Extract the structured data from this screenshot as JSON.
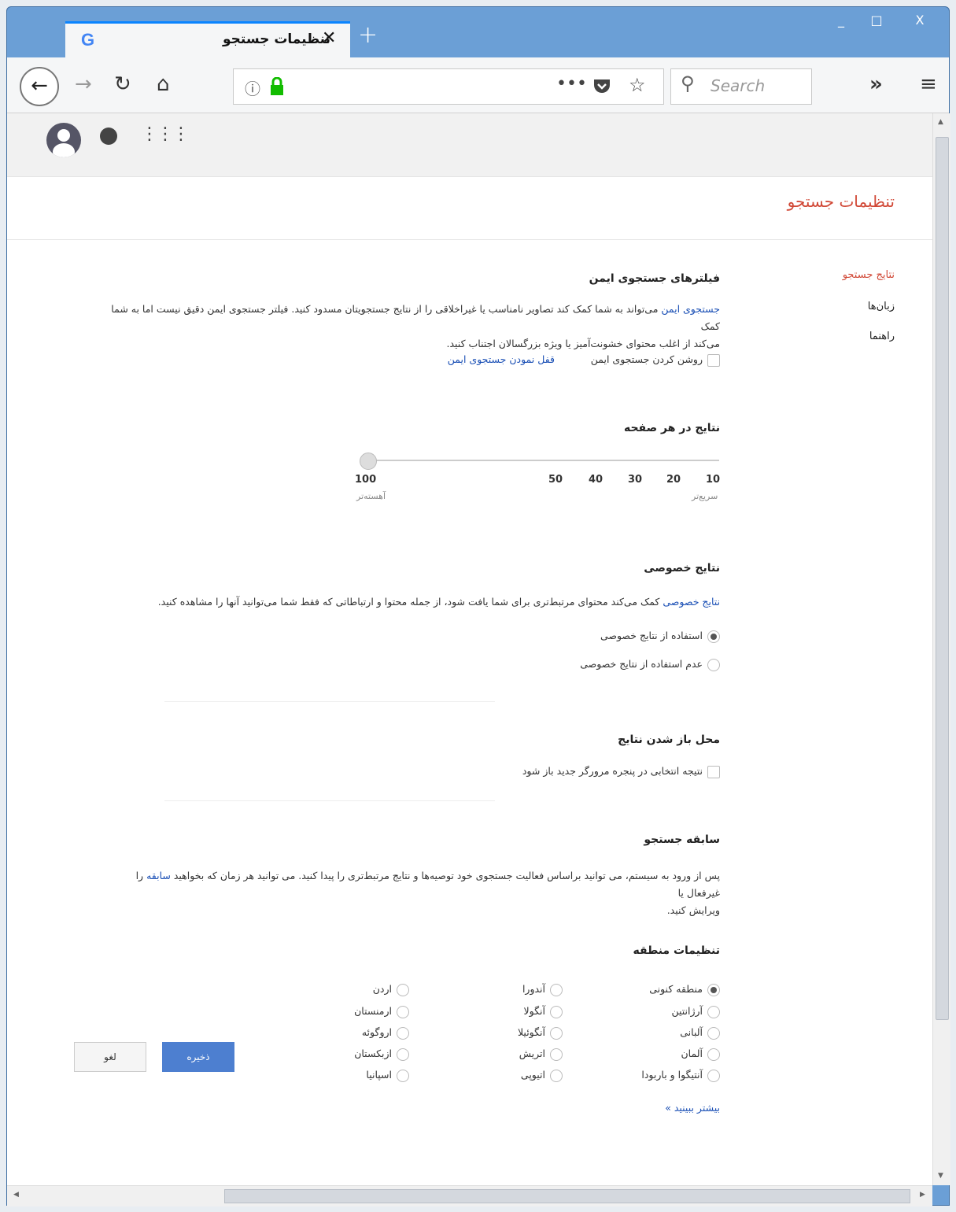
{
  "browser": {
    "tab_title": "تنظیمات جستجو",
    "tab_favicon": "G",
    "close_glyph": "✕",
    "new_tab_glyph": "+",
    "url_info_glyph": "ⓘ",
    "search_placeholder": "Search",
    "window_controls": [
      "_",
      "□",
      "X"
    ]
  },
  "page": {
    "title": "تنظیمات جستجو",
    "sidebar": [
      "نتایج جستجو",
      "زبان‌ها",
      "راهنما"
    ],
    "safesearch": {
      "title": "فیلترهای جستجوی ایمن",
      "link": "جستجوی ایمن",
      "text1": " می‌تواند به شما کمک کند تصاویر نامناسب یا غیراخلاقی را از نتایج جستجویتان مسدود کنید. فیلتر جستجوی ایمن دقیق نیست اما به شما کمک",
      "text2": "می‌کند از اغلب محتوای خشونت‌آمیز یا ویژه بزرگسالان اجتناب کنید.",
      "checkbox_label": "روشن کردن جستجوی ایمن",
      "lock_link": "قفل نمودن جستجوی ایمن"
    },
    "results_per_page": {
      "title": "نتایج در هر صفحه",
      "ticks": [
        "10",
        "20",
        "30",
        "40",
        "50",
        "100"
      ],
      "faster": "سریع‌تر",
      "slower": "آهسته‌تر",
      "selected": "100"
    },
    "private_results": {
      "title": "نتایج خصوصی",
      "link": "نتایج خصوصی",
      "text": " کمک می‌کند محتوای مرتبط‌تری برای شما یافت شود، از جمله محتوا و ارتباطاتی که فقط شما می‌توانید آنها را مشاهده کنید.",
      "opt_use": "استفاده از نتایج خصوصی",
      "opt_nouse": "عدم استفاده از نتایج خصوصی"
    },
    "open_results": {
      "title": "محل باز شدن نتایج",
      "checkbox_label": "نتیجه انتخابی در پنجره مرورگر جدید باز شود"
    },
    "history": {
      "title": "سابقه جستجو",
      "text1": "پس از ورود به سیستم، می توانید براساس فعالیت جستجوی خود توصیه‌ها و نتایج مرتبط‌تری را پیدا کنید. می توانید هر زمان که بخواهید ",
      "link": "سابقه",
      "text2": " را غیرفعال یا",
      "text3": "ویرایش کنید."
    },
    "region": {
      "title": "تنظیمات منطقه",
      "col1": [
        "منطقه کنونی",
        "آرژانتین",
        "آلبانی",
        "آلمان",
        "آنتیگوا و باربودا"
      ],
      "col2": [
        "آندورا",
        "آنگولا",
        "آنگوئیلا",
        "اتریش",
        "اتیوپی"
      ],
      "col3": [
        "اردن",
        "ارمنستان",
        "اروگوئه",
        "ازبکستان",
        "اسپانیا"
      ],
      "more": "بیشتر ببینید »"
    },
    "buttons": {
      "save": "ذخیره",
      "cancel": "لغو"
    }
  }
}
